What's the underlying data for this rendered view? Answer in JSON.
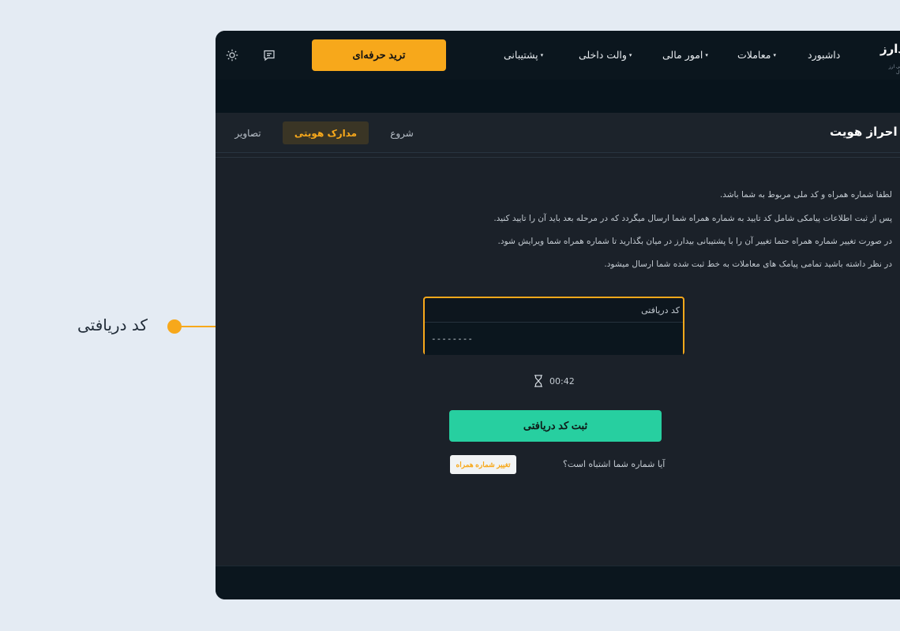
{
  "callout": {
    "label": "کد دریافتی",
    "color": "#f7a81b"
  },
  "header": {
    "logo": "بیدارز",
    "logo_sub": "صرافی ارز دیجیتال",
    "nav": [
      {
        "label": "داشبورد",
        "has_caret": false
      },
      {
        "label": "معاملات",
        "has_caret": true
      },
      {
        "label": "امور مالی",
        "has_caret": true
      },
      {
        "label": "والت داخلی",
        "has_caret": true
      },
      {
        "label": "پشتیبانی",
        "has_caret": true
      }
    ],
    "trade_button": "ترید حرفه‌ای",
    "caret": "▾",
    "icons": [
      "chat-icon",
      "sun-icon"
    ]
  },
  "page": {
    "title": "احراز هویت",
    "tabs": [
      {
        "label": "شروع",
        "active": false
      },
      {
        "label": "مدارک هویتی",
        "active": true
      },
      {
        "label": "تصاویر",
        "active": false
      }
    ],
    "info_lines": [
      "لطفا شماره همراه و کد ملی مربوط به شما باشد.",
      "پس از ثبت اطلاعات پیامکی شامل کد تایید به شماره همراه شما ارسال میگردد که در مرحله بعد باید آن را تایید کنید.",
      "در صورت تغییر شماره همراه حتما تغییر آن را با پشتیبانی بیدارز در میان بگذارید تا شماره همراه شما ویرایش شود.",
      "در نظر داشته باشید تمامی پیامک های معاملات به خط ثبت شده شما ارسال میشود."
    ],
    "code_field": {
      "label": "کد دریافتی",
      "placeholder": "--------"
    },
    "timer": "00:42",
    "submit_button": "ثبت کد دریافتی",
    "wrong_number_question": "آیا شماره شما اشتباه است؟",
    "change_number_button": "تغییر شماره همراه"
  },
  "colors": {
    "accent": "#f7a81b",
    "success": "#27cfa0",
    "background": "#1b2129",
    "topbar": "#0b161e"
  }
}
